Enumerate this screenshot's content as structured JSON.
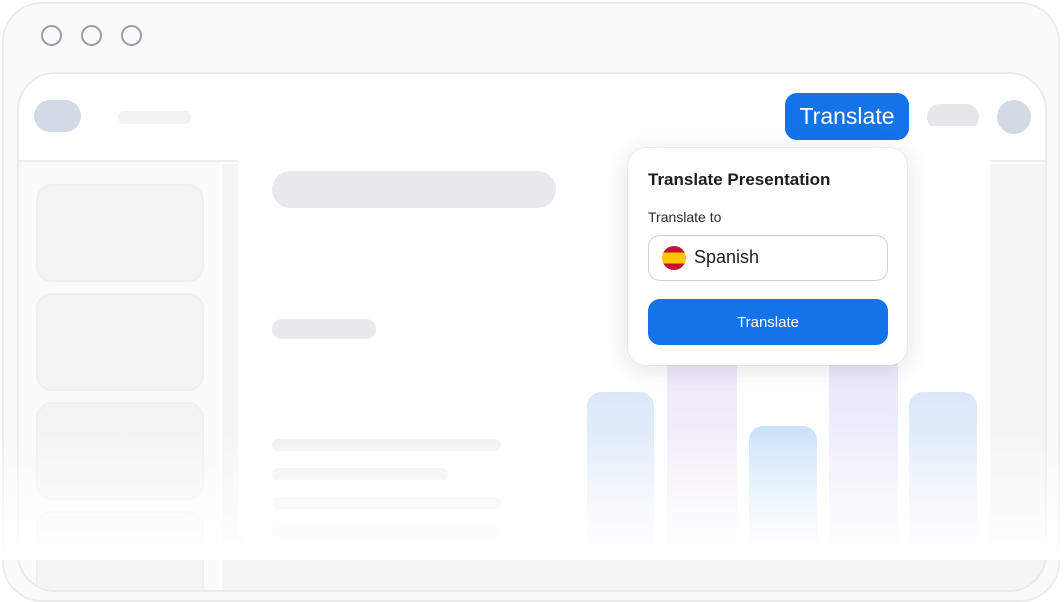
{
  "toolbar": {
    "translate_button_label": "Translate"
  },
  "translate_popover": {
    "title": "Translate Presentation",
    "target_label": "Translate to",
    "selected_language": "Spanish",
    "selected_language_flag": "spain-flag-icon",
    "submit_label": "Translate"
  },
  "colors": {
    "accent": "#1573E9",
    "chart_bars": [
      "#DCE8F9",
      "#EEE8F8",
      "#CBE2FA",
      "#E6E8FA",
      "#DCE8F9"
    ]
  }
}
